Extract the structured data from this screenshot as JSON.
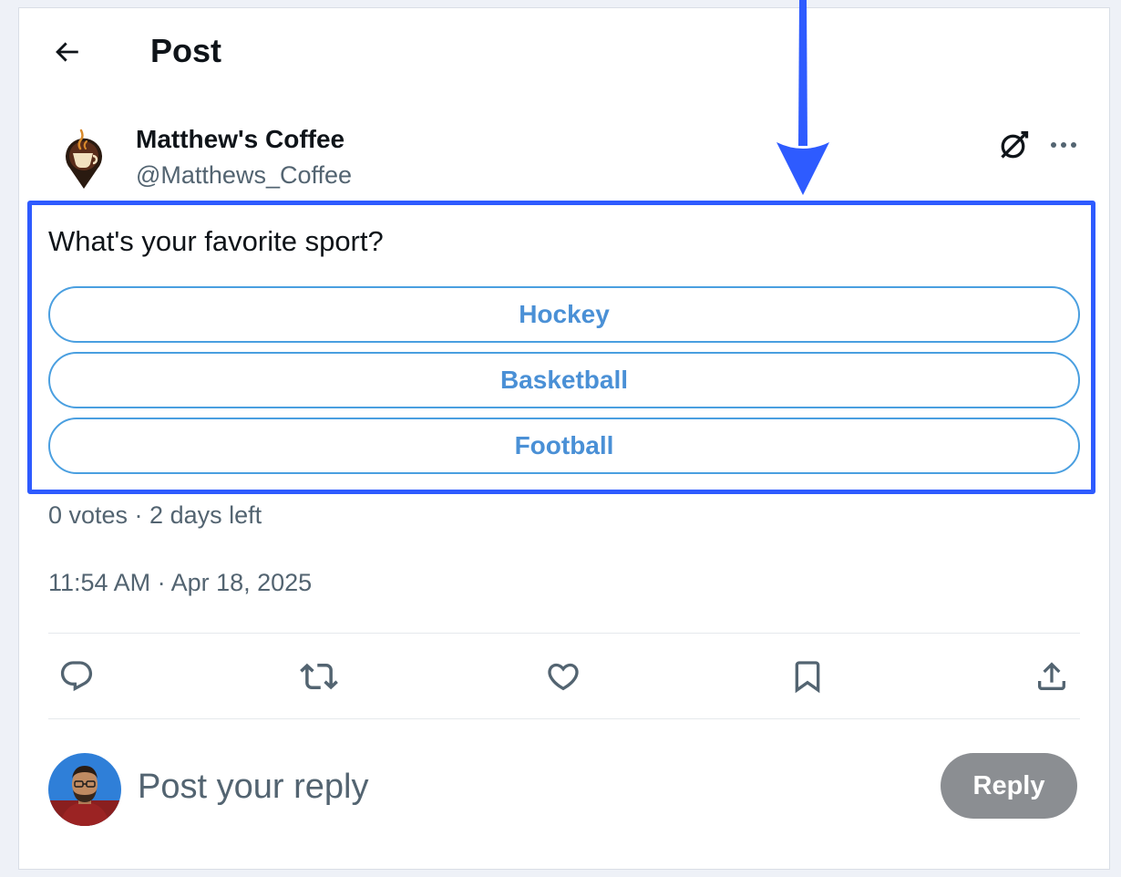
{
  "header": {
    "back_icon": "arrow-left-icon",
    "title": "Post"
  },
  "post": {
    "author": {
      "name": "Matthew's Coffee",
      "handle": "@Matthews_Coffee",
      "logo_icon": "coffee-cup-pin-logo"
    },
    "grok_icon": "grok-icon",
    "more_icon": "more-horizontal-icon",
    "poll": {
      "question": "What's your favorite sport?",
      "options": [
        "Hockey",
        "Basketball",
        "Football"
      ],
      "meta": "0 votes · 2 days left"
    },
    "timestamp": "11:54 AM · Apr 18, 2025",
    "actions": [
      "reply-icon",
      "repost-icon",
      "like-icon",
      "bookmark-icon",
      "share-icon"
    ]
  },
  "reply": {
    "placeholder": "Post your reply",
    "button_label": "Reply"
  },
  "annotation": {
    "highlight_color": "#2e5bff",
    "arrow_color": "#2e5bff"
  },
  "colors": {
    "accent": "#1d9bf0",
    "poll_option_text": "#4a90d6",
    "reply_button_disabled": "#8b8e92",
    "secondary_text": "#536471",
    "primary_text": "#0f1419"
  }
}
